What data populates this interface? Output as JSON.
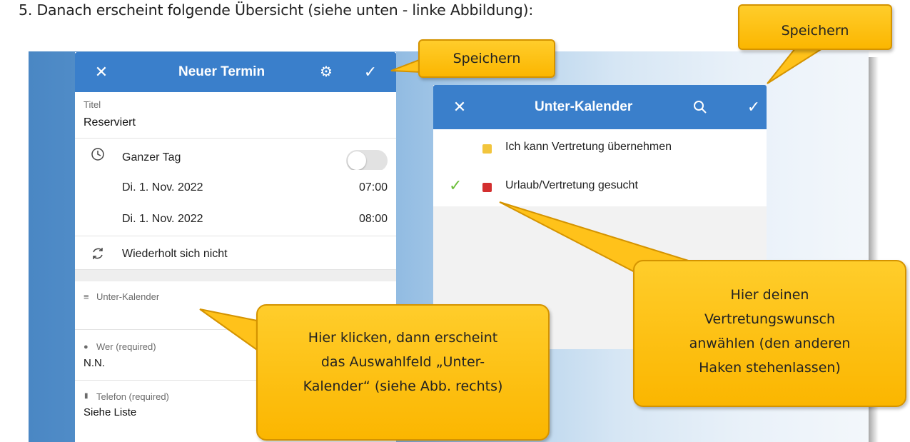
{
  "heading": "5.  Danach erscheint folgende Übersicht (siehe unten - linke Abbildung):",
  "left_phone": {
    "appbar": {
      "title": "Neuer Termin",
      "close_icon": "✕",
      "settings_icon": "⚙",
      "check_icon": "✓"
    },
    "title_label": "Titel",
    "title_value": "Reserviert",
    "allday_label": "Ganzer Tag",
    "allday_on": false,
    "start_date": "Di. 1. Nov. 2022",
    "start_time": "07:00",
    "end_date": "Di. 1. Nov. 2022",
    "end_time": "08:00",
    "repeat_label": "Wiederholt sich nicht",
    "subcal_label": "Unter-Kalender",
    "who_label": "Wer (required)",
    "who_value": "N.N.",
    "phone_label": "Telefon (required)",
    "phone_value": "Siehe Liste"
  },
  "right_phone": {
    "appbar": {
      "title": "Unter-Kalender",
      "close_icon": "✕",
      "search_icon": "⌕",
      "check_icon": "✓"
    },
    "items": [
      {
        "name": "Ich kann Vertretung übernehmen",
        "color": "#f2c53d",
        "checked": false
      },
      {
        "name": "Urlaub/Vertretung gesucht",
        "color": "#d32f2f",
        "checked": true
      }
    ]
  },
  "callouts": {
    "save_left": "Speichern",
    "save_right": "Speichern",
    "click_hint": [
      "Hier klicken, dann erscheint",
      "das Auswahlfeld „Unter-",
      "Kalender“ (siehe Abb. rechts)"
    ],
    "choose_hint": [
      "Hier deinen",
      "Vertretungswunsch",
      "anwählen (den anderen",
      "Haken stehenlassen)"
    ]
  }
}
